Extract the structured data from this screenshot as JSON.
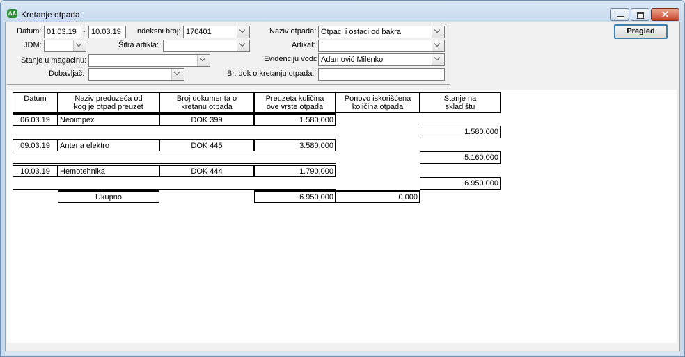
{
  "window": {
    "title": "Kretanje otpada"
  },
  "filters": {
    "datum_label": "Datum:",
    "datum_from": "01.03.19",
    "datum_sep": "-",
    "datum_to": "10.03.19",
    "indeksni_label": "Indeksni broj:",
    "indeksni_value": "170401",
    "naziv_label": "Naziv otpada:",
    "naziv_value": "Otpaci i ostaci od bakra",
    "jdm_label": "JDM:",
    "jdm_value": "",
    "sifra_label": "Šifra artikla:",
    "sifra_value": "",
    "artikal_label": "Artikal:",
    "artikal_value": "",
    "stanje_label": "Stanje u magacinu:",
    "stanje_value": "",
    "evidenciju_label": "Evidenciju vodi:",
    "evidenciju_value": "Adamović Milenko",
    "dobavljac_label": "Dobavljač:",
    "dobavljac_value": "",
    "brdok_label": "Br. dok o kretanju otpada:",
    "brdok_value": ""
  },
  "toolbar": {
    "pregled_label": "Pregled"
  },
  "table": {
    "headers": {
      "datum": "Datum",
      "naziv_1": "Naziv preduzeća od",
      "naziv_2": "kog je otpad preuzet",
      "broj_1": "Broj dokumenta o",
      "broj_2": "kretanu otpada",
      "preuzeta_1": "Preuzeta količina",
      "preuzeta_2": "ove vrste otpada",
      "ponovo_1": "Ponovo iskorišćena",
      "ponovo_2": "količina otpada",
      "stanje_1": "Stanje na",
      "stanje_2": "skladištu"
    },
    "rows": [
      {
        "datum": "06.03.19",
        "naziv": "Neoimpex",
        "broj": "DOK 399",
        "preuzeta": "1.580,000",
        "stanje": "1.580,000"
      },
      {
        "datum": "09.03.19",
        "naziv": "Antena elektro",
        "broj": "DOK 445",
        "preuzeta": "3.580,000",
        "stanje": "5.160,000"
      },
      {
        "datum": "10.03.19",
        "naziv": "Hemotehnika",
        "broj": "DOK 444",
        "preuzeta": "1.790,000",
        "stanje": "6.950,000"
      }
    ],
    "total": {
      "label": "Ukupno",
      "preuzeta": "6.950,000",
      "ponovo": "0,000"
    }
  }
}
